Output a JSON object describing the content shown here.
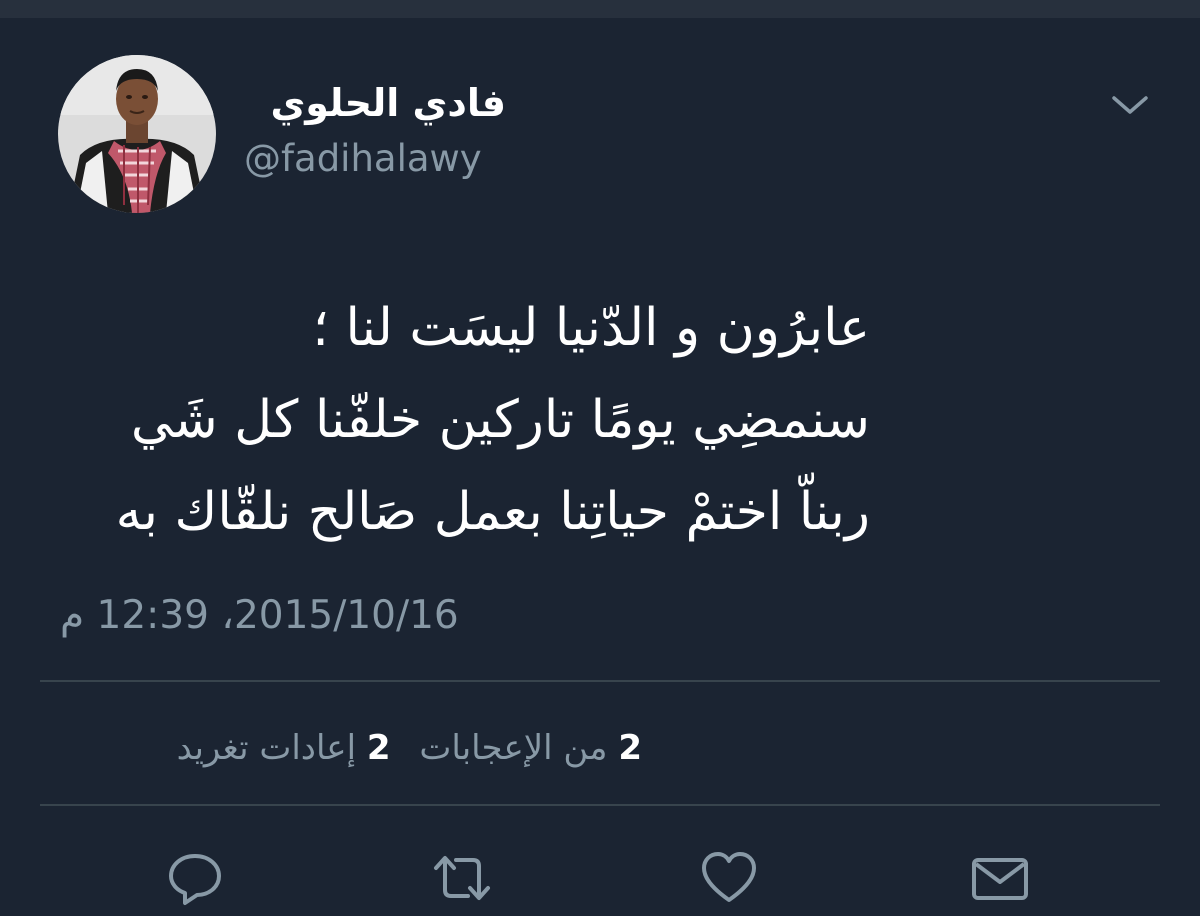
{
  "user": {
    "display_name": "فادي الحلوي",
    "handle": "@fadihalawy",
    "avatar": "profile-photo"
  },
  "tweet": {
    "lines": [
      "عابرُون و الدّنيا ليسَت لنا ؛",
      "سنمضِي يومًا تاركين خلفّنا كل شَي",
      "ربناّ اختمْ حياتِنا بعمل صَالح نلقّاك به"
    ],
    "timestamp": "2015/10/16، 12:39 م"
  },
  "stats": {
    "likes_count": "2",
    "likes_label": "من الإعجابات",
    "retweets_count": "2",
    "retweets_label": "إعادات تغريد"
  },
  "icons": {
    "menu": "chevron-down-icon",
    "reply": "reply-icon",
    "retweet": "retweet-icon",
    "like": "heart-icon",
    "message": "mail-icon"
  },
  "colors": {
    "background": "#1b2432",
    "text": "#ffffff",
    "muted": "#8899a6",
    "divider": "#38444d"
  }
}
